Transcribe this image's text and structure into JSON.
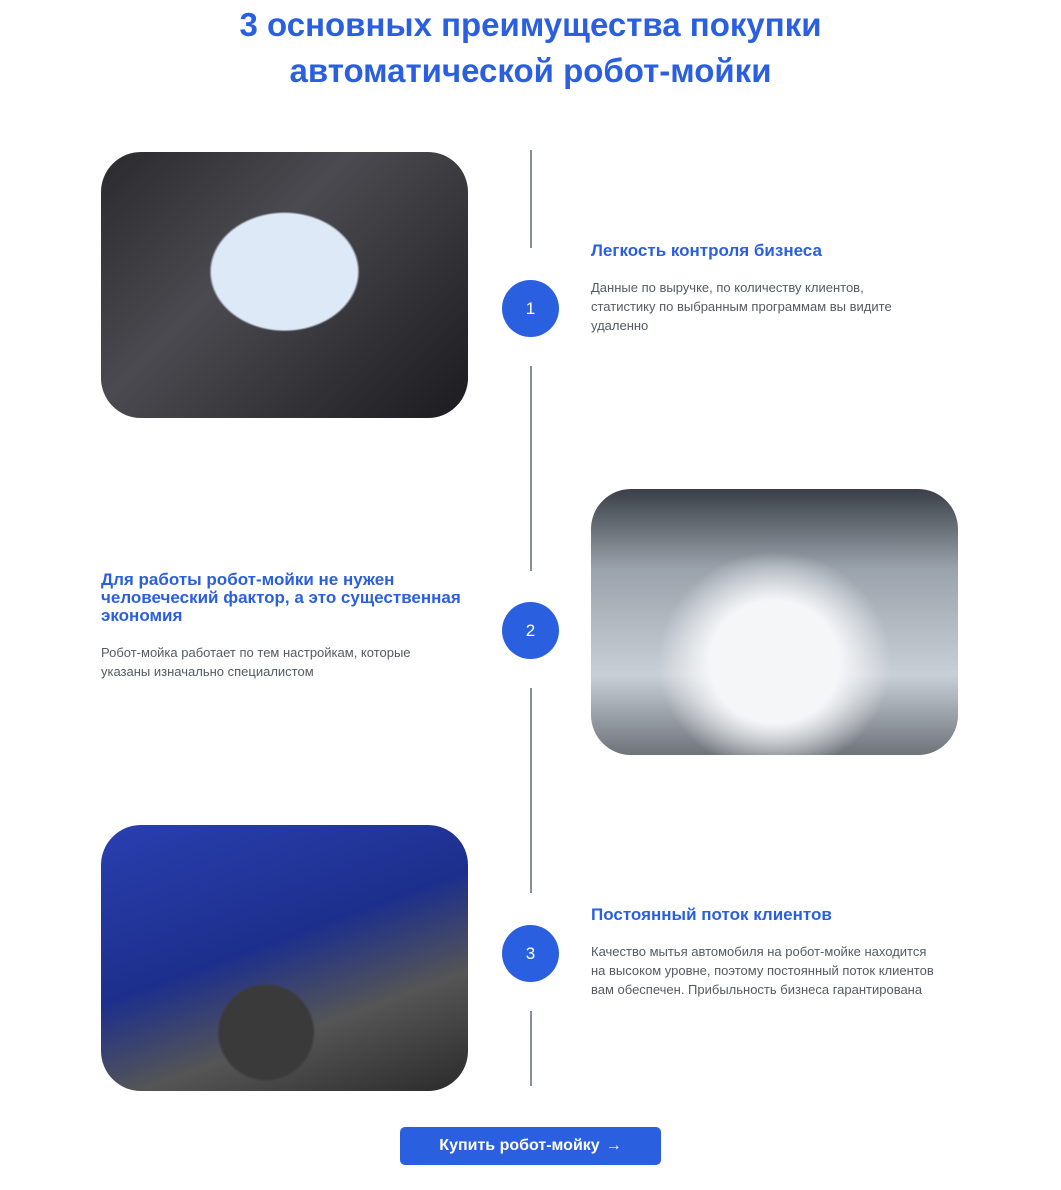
{
  "title": {
    "line1": "3 основных преимущества покупки",
    "line2": "автоматической робот-мойки"
  },
  "items": [
    {
      "number": "1",
      "heading": "Легкость контроля бизнеса",
      "text": "Данные по выручке, по количеству клиентов, статистику по выбранным программам вы видите удаленно"
    },
    {
      "number": "2",
      "heading": "Для работы робот-мойки не нужен человеческий фактор, а это существенная экономия",
      "text": "Робот-мойка работает по тем настройкам, которые указаны изначально специалистом"
    },
    {
      "number": "3",
      "heading": "Постоянный поток клиентов",
      "text": "Качество мытья автомобиля на робот-мойке находится на высоком уровне, поэтому постоянный поток клиентов вам обеспечен. Прибыльность бизнеса гарантирована"
    }
  ],
  "cta": {
    "label": "Купить робот-мойку",
    "icon": "→"
  },
  "colors": {
    "accent": "#2a5fe0"
  }
}
